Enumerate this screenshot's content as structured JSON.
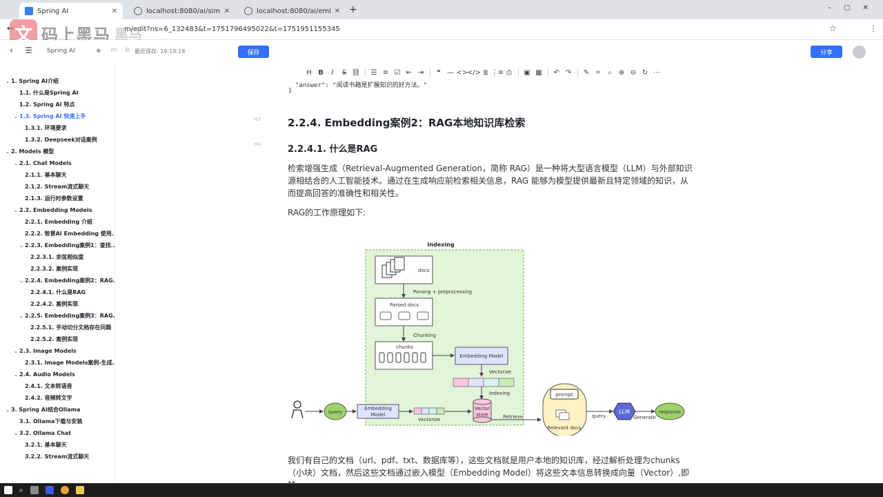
{
  "browser": {
    "tabs": [
      {
        "label": "Spring AI",
        "active": true
      },
      {
        "label": "localhost:8080/ai/similarity?",
        "active": false
      },
      {
        "label": "localhost:8080/ai/embeddin",
        "active": false
      }
    ],
    "url": "m/edit?ns=6_132483&t=1751796495022&t=1751951155345",
    "new_tab": "+"
  },
  "watermark": {
    "mark": "文",
    "name": "码上黑马",
    "sub": "黑马"
  },
  "header": {
    "breadcrumb": "Spring AI",
    "saved_status": "最近保存: 19:19:18",
    "save_label": "保存",
    "share_label": "分享"
  },
  "toc": [
    {
      "label": "1. Spring AI介绍",
      "level": 0,
      "caret": "v",
      "bold": true
    },
    {
      "label": "1.1. 什么是Spring AI",
      "level": 1,
      "bold": true
    },
    {
      "label": "1.2. Spring AI 特点",
      "level": 1,
      "bold": true
    },
    {
      "label": "1.3. Spring AI 快速上手",
      "level": 1,
      "caret": "v",
      "bold": true,
      "active": true
    },
    {
      "label": "1.3.1. 环境要求",
      "level": 2,
      "bold": true
    },
    {
      "label": "1.3.2. Deepseek对话案例",
      "level": 2,
      "bold": true
    },
    {
      "label": "2. Models 模型",
      "level": 0,
      "caret": "v",
      "bold": true
    },
    {
      "label": "2.1. Chat Models",
      "level": 1,
      "caret": "v",
      "bold": true
    },
    {
      "label": "2.1.1. 基本聊天",
      "level": 2,
      "bold": true
    },
    {
      "label": "2.1.2. Stream流式聊天",
      "level": 2,
      "bold": true
    },
    {
      "label": "2.1.3. 运行时参数设置",
      "level": 2,
      "bold": true
    },
    {
      "label": "2.2. Embedding Models",
      "level": 1,
      "caret": "v",
      "bold": true
    },
    {
      "label": "2.2.1. Embedding 介绍",
      "level": 2,
      "bold": true
    },
    {
      "label": "2.2.2. 智普AI Embedding 使用...",
      "level": 2,
      "bold": true
    },
    {
      "label": "2.2.3. Embedding案例1：查找...",
      "level": 2,
      "caret": "v",
      "bold": true
    },
    {
      "label": "2.2.3.1. 余弦相似度",
      "level": 3,
      "bold": true
    },
    {
      "label": "2.2.3.2. 案例实现",
      "level": 3,
      "bold": true
    },
    {
      "label": "2.2.4. Embedding案例2：RAG...",
      "level": 2,
      "caret": "v",
      "bold": true
    },
    {
      "label": "2.2.4.1. 什么是RAG",
      "level": 3,
      "bold": true
    },
    {
      "label": "2.2.4.2. 案例实现",
      "level": 3,
      "bold": true
    },
    {
      "label": "2.2.5. Embedding案例3：RAG...",
      "level": 2,
      "caret": "v",
      "bold": true
    },
    {
      "label": "2.2.5.1. 手动切分文档存在问题",
      "level": 3,
      "bold": true
    },
    {
      "label": "2.2.5.2. 案例实现",
      "level": 3,
      "bold": true
    },
    {
      "label": "2.3. Image Models",
      "level": 1,
      "caret": "v",
      "bold": true
    },
    {
      "label": "2.3.1. Image Models案例-生成...",
      "level": 2,
      "bold": true
    },
    {
      "label": "2.4. Audio Models",
      "level": 1,
      "caret": "v",
      "bold": true
    },
    {
      "label": "2.4.1. 文本转语音",
      "level": 2,
      "bold": true
    },
    {
      "label": "2.4.2. 音频转文字",
      "level": 2,
      "bold": true
    },
    {
      "label": "3. Spring AI结合Ollama",
      "level": 0,
      "caret": "v",
      "bold": true
    },
    {
      "label": "3.1. Ollama下载与安装",
      "level": 1,
      "bold": true
    },
    {
      "label": "3.2. Ollama Chat",
      "level": 1,
      "caret": "v",
      "bold": true
    },
    {
      "label": "3.2.1. 基本聊天",
      "level": 2,
      "bold": true
    },
    {
      "label": "3.2.2. Stream流式聊天",
      "level": 2,
      "bold": true
    }
  ],
  "toolbar": {
    "icons": [
      "heading-icon",
      "bold-icon",
      "italic-icon",
      "strikethrough-icon",
      "link-icon",
      "|",
      "bullet-list-icon",
      "ordered-list-icon",
      "task-list-icon",
      "outdent-icon",
      "indent-icon",
      "|",
      "quote-icon",
      "divider-icon",
      "code-inline-icon",
      "code-block-icon",
      "align-icon",
      "table-of-contents-icon",
      "print-icon",
      "|",
      "image-icon",
      "table-icon",
      "|",
      "undo-icon",
      "redo-icon",
      "|",
      "pen-icon",
      "format-icon",
      "find-icon",
      "zoom-in-icon",
      "zoom-out-icon",
      "refresh-icon",
      "more-icon"
    ],
    "glyphs": [
      "H",
      "B",
      "I",
      "S",
      "⛓",
      "|",
      "☰",
      "≡",
      "☑",
      "⇤",
      "⇥",
      "|",
      "❝",
      "—",
      "<>",
      "</>",
      "≣",
      "⋮≡",
      "⎙",
      "|",
      "▣",
      "▦",
      "|",
      "↶",
      "↷",
      "|",
      "✎",
      "⌗",
      "⌕",
      "⊕",
      "⊖",
      "↻",
      "⋯"
    ]
  },
  "document": {
    "code_line1": "\"answer\": \"阅读书籍是扩展知识的好方法。\"",
    "code_line2": "}",
    "heading_mark_h3": "H3",
    "heading_mark_h4": "H4",
    "h3": "2.2.4. Embedding案例2：RAG本地知识库检索",
    "h4": "2.2.4.1. 什么是RAG",
    "para1": "检索增强生成（Retrieval-Augmented Generation，简称 RAG）是一种将大型语言模型（LLM）与外部知识源相结合的人工智能技术。通过在生成响应前检索相关信息，RAG 能够为模型提供最新且特定领域的知识，从而提高回答的准确性和相关性。",
    "para2": "RAG的工作原理如下:",
    "para3": "我们有自己的文档（url、pdf、txt、数据库等），这些文档就是用户本地的知识库，经过解析处理为chunks（小块）文档，然后这些文档通过嵌入模型（Embedding Model）将这些文本信息转换成向量（Vector）,即转"
  },
  "diagram": {
    "indexing_title": "Indexing",
    "docs": "docs",
    "parsing": "Parsing + preprocessing",
    "parsed_docs": "Parsed docs",
    "chunking": "Chunking",
    "chunks": "chunks",
    "embedding_model": "Embedding Model",
    "vectorize": "Vectorize",
    "indexing": "Indexing",
    "query": "query",
    "embedding_model_line1": "Embedding",
    "embedding_model_line2": "Model",
    "vectorize_bottom": "Vectorize",
    "vector_store_line1": "Vector",
    "vector_store_line2": "store",
    "retrieve": "Retrieve",
    "prompt": "prompt",
    "relevant_docs": "Relevant docs",
    "query2": "query",
    "llm": "LLM",
    "generate": "Generate",
    "response": "response",
    "colors": {
      "green_box": "#e2f4d9",
      "green_node": "#9ed36a",
      "blue_box": "#dde4ff",
      "yellow": "#fff2c4",
      "pink": "#f8c6de",
      "llm": "#5b6ad8"
    }
  }
}
